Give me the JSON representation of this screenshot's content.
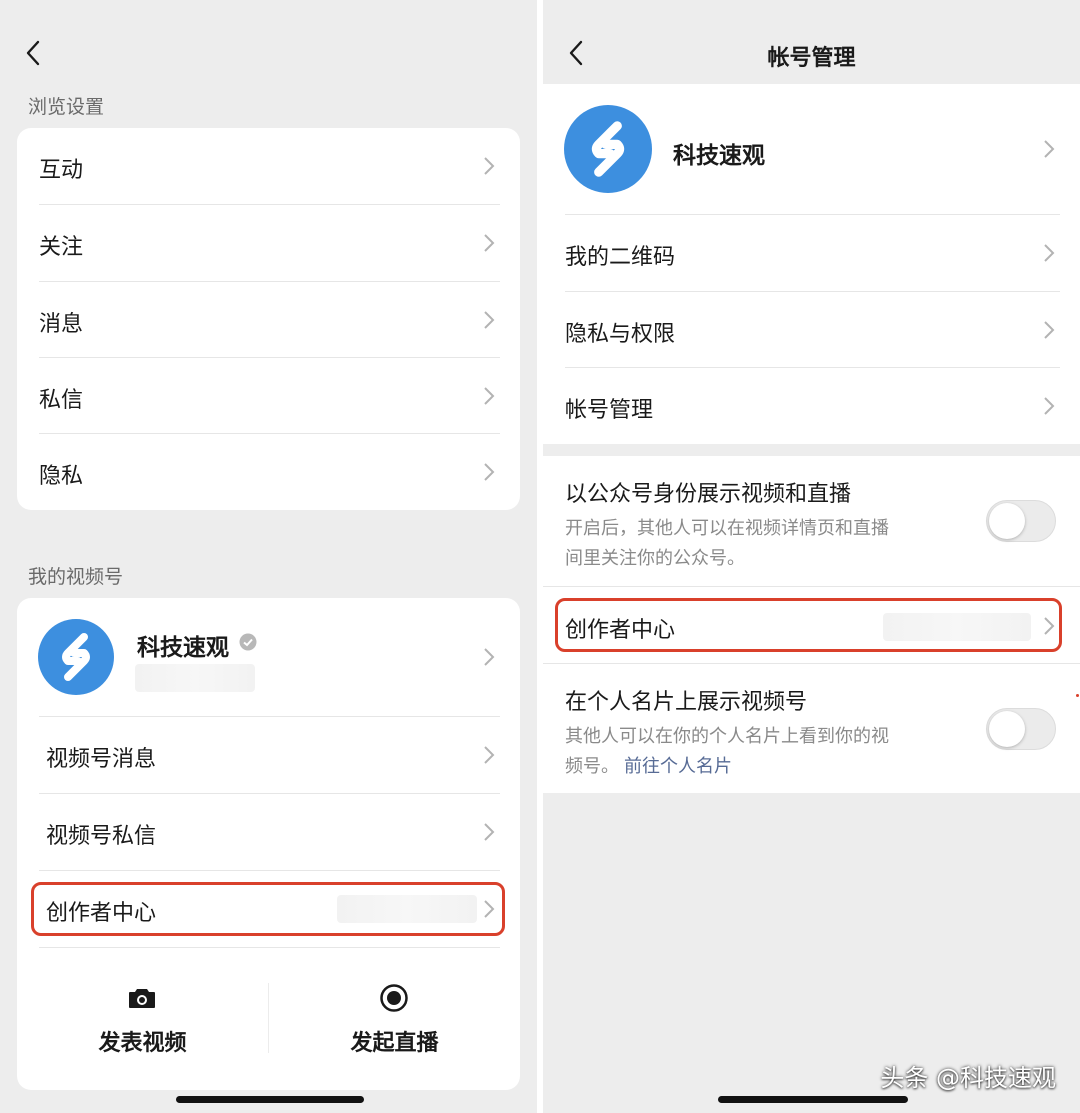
{
  "left": {
    "browse_settings_label": "浏览设置",
    "browse_items": [
      {
        "label": "互动"
      },
      {
        "label": "关注"
      },
      {
        "label": "消息"
      },
      {
        "label": "私信"
      },
      {
        "label": "隐私"
      }
    ],
    "my_channel_label": "我的视频号",
    "channel": {
      "name": "科技速观",
      "items": [
        {
          "label": "视频号消息"
        },
        {
          "label": "视频号私信"
        },
        {
          "label": "创作者中心"
        }
      ]
    },
    "actions": {
      "post_video": "发表视频",
      "start_live": "发起直播"
    }
  },
  "right": {
    "title": "帐号管理",
    "profile_name": "科技速观",
    "items": [
      {
        "label": "我的二维码"
      },
      {
        "label": "隐私与权限"
      },
      {
        "label": "帐号管理"
      }
    ],
    "toggle_official": {
      "title": "以公众号身份展示视频和直播",
      "desc_line1": "开启后，其他人可以在视频详情页和直播",
      "desc_line2": "间里关注你的公众号。",
      "on": false
    },
    "creator_center": "创作者中心",
    "toggle_card": {
      "title": "在个人名片上展示视频号",
      "desc_line1": "其他人可以在你的个人名片上看到你的视",
      "desc_prefix": "频号。",
      "desc_link": "前往个人名片",
      "on": false
    }
  },
  "watermark": "头条 @科技速观",
  "colors": {
    "highlight": "#d9402b",
    "link": "#576b95",
    "avatar": "#3d8fdf",
    "background": "#ededed"
  }
}
